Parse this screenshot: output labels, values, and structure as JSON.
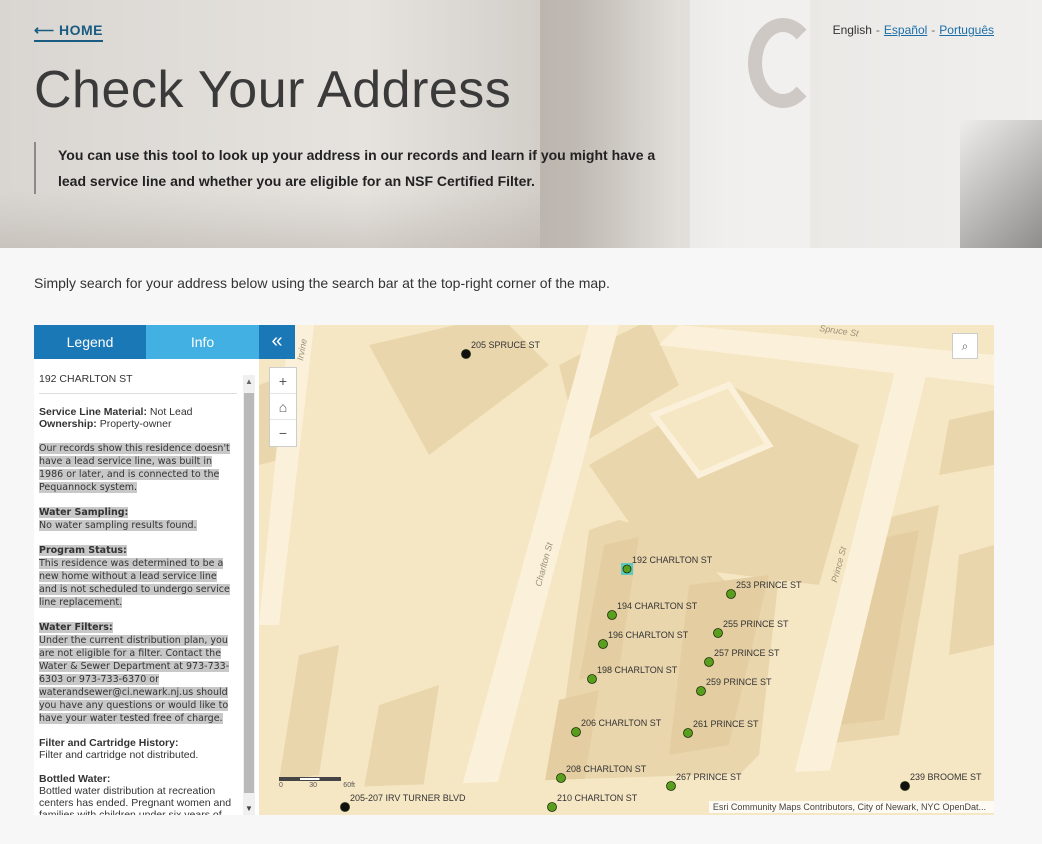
{
  "header": {
    "home_link": "⟵ HOME",
    "languages": {
      "current": "English",
      "links": [
        "Español",
        "Português"
      ],
      "separator": "-"
    },
    "title": "Check Your Address",
    "description": "You can use this tool to look up your address in our records and learn if you might have a lead service line and whether you are eligible for an NSF Certified Filter."
  },
  "instruction": "Simply search for your address below using the search bar at the top-right corner of the map.",
  "panel": {
    "tabs": {
      "legend": "Legend",
      "info": "Info",
      "collapse_icon": "«"
    },
    "address": "192 CHARLTON ST",
    "service_line_label": "Service Line Material:",
    "service_line_value": "Not Lead",
    "ownership_label": "Ownership:",
    "ownership_value": "Property-owner",
    "records_text": "Our records show this residence doesn't have a lead service line, was built in 1986 or later, and is connected to the Pequannock system.",
    "water_sampling_label": "Water Sampling:",
    "water_sampling_value": "No water sampling results found.",
    "program_status_label": "Program Status:",
    "program_status_value": "This residence was determined to be a new home without a lead service line and is not scheduled to undergo service line replacement.",
    "water_filters_label": "Water Filters:",
    "water_filters_value": "Under the current distribution plan, you are not eligible for a filter. Contact the Water & Sewer Department at 973-733-6303 or 973-733-6370 or waterandsewer@ci.newark.nj.us should you have any questions or would like to have your water tested free of charge.",
    "filter_history_label": "Filter and Cartridge History:",
    "filter_history_value": "Filter and cartridge not distributed.",
    "bottled_water_label": "Bottled Water:",
    "bottled_water_value": "Bottled water distribution at recreation centers has ended. Pregnant women and families with children under six years of age can still pick up at two"
  },
  "map": {
    "zoom_in": "+",
    "home_icon": "home-icon",
    "zoom_out": "−",
    "search_icon": "search-icon",
    "scale": [
      "0",
      "30",
      "60ft"
    ],
    "attribution": "Esri Community Maps Contributors, City of Newark, NYC OpenDat...",
    "streets": [
      "Charlton St",
      "Prince St",
      "Spruce St",
      "Irvine"
    ],
    "points": [
      {
        "label": "205 SPRUCE ST",
        "status": "black"
      },
      {
        "label": "192 CHARLTON ST",
        "status": "selected"
      },
      {
        "label": "194 CHARLTON ST",
        "status": "green"
      },
      {
        "label": "196 CHARLTON ST",
        "status": "green"
      },
      {
        "label": "198 CHARLTON ST",
        "status": "green"
      },
      {
        "label": "206 CHARLTON ST",
        "status": "green"
      },
      {
        "label": "208 CHARLTON ST",
        "status": "green"
      },
      {
        "label": "210 CHARLTON ST",
        "status": "green"
      },
      {
        "label": "253 PRINCE ST",
        "status": "green"
      },
      {
        "label": "255 PRINCE ST",
        "status": "green"
      },
      {
        "label": "257 PRINCE ST",
        "status": "green"
      },
      {
        "label": "259 PRINCE ST",
        "status": "green"
      },
      {
        "label": "261 PRINCE ST",
        "status": "green"
      },
      {
        "label": "267 PRINCE ST",
        "status": "green"
      },
      {
        "label": "239 BROOME ST",
        "status": "black"
      },
      {
        "label": "205-207 IRV TURNER BLVD",
        "status": "black"
      }
    ],
    "colors": {
      "green": "#5a9e1e",
      "black": "#111111",
      "selected": "#3ac8c8",
      "land": "#f6e7c4",
      "road": "#fbf1da",
      "block": "#ead6ad"
    }
  }
}
